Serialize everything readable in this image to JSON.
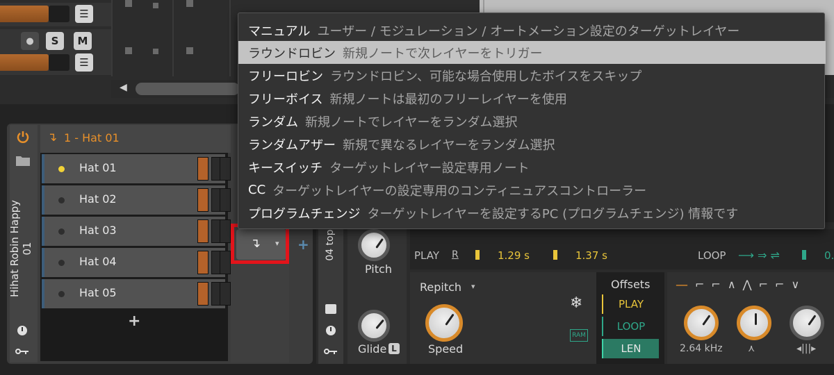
{
  "mixer": {
    "solo_label": "S",
    "mute_label": "M",
    "menu_glyph": "☰",
    "record_glyph": "●",
    "scroll_left_glyph": "◀"
  },
  "device": {
    "title": "Hihat Robin Happy 01",
    "layer_header": "1 - Hat 01",
    "add_glyph": "+",
    "power_icon": "power-icon",
    "folder_icon": "folder-icon",
    "layers": [
      {
        "name": "Hat 01",
        "active": true
      },
      {
        "name": "Hat 02",
        "active": false
      },
      {
        "name": "Hat 03",
        "active": false
      },
      {
        "name": "Hat 04",
        "active": false
      },
      {
        "name": "Hat 05",
        "active": false
      }
    ],
    "mode_button_glyph": "↴",
    "mode_dropdown_glyph": "▾"
  },
  "sampler": {
    "side_title": "04 top",
    "pitch_label": "Pitch",
    "glide_label": "Glide",
    "glide_badge": "L",
    "play_label": "PLAY",
    "r_label": "R",
    "play_start": "1.29 s",
    "play_end": "1.37 s",
    "loop_label": "LOOP",
    "loop_value": "0.",
    "repitch_label": "Repitch",
    "speed_label": "Speed",
    "ram_label": "RAM",
    "offsets_label": "Offsets",
    "offsets_buttons": [
      "PLAY",
      "LOOP",
      "LEN"
    ],
    "freq_label": "2.64 kHz",
    "snowflake_glyph": "❄"
  },
  "menu": {
    "items": [
      {
        "label": "マニュアル",
        "desc": "ユーザー / モジュレーション / オートメーション設定のターゲットレイヤー",
        "selected": false
      },
      {
        "label": "ラウンドロビン",
        "desc": "新規ノートで次レイヤーをトリガー",
        "selected": true
      },
      {
        "label": "フリーロビン",
        "desc": "ラウンドロビン、可能な場合使用したボイスをスキップ",
        "selected": false
      },
      {
        "label": "フリーボイス",
        "desc": "新規ノートは最初のフリーレイヤーを使用",
        "selected": false
      },
      {
        "label": "ランダム",
        "desc": "新規ノートでレイヤーをランダム選択",
        "selected": false
      },
      {
        "label": "ランダムアザー",
        "desc": "新規で異なるレイヤーをランダム選択",
        "selected": false
      },
      {
        "label": "キースイッチ",
        "desc": "ターゲットレイヤー設定専用ノート",
        "selected": false
      },
      {
        "label": "CC",
        "desc": "ターゲットレイヤーの設定専用のコンティニュアスコントローラー",
        "selected": false
      },
      {
        "label": "プログラムチェンジ",
        "desc": "ターゲットレイヤーを設定するPC (プログラムチェンジ) 情報です",
        "selected": false
      }
    ]
  },
  "colors": {
    "accent_orange": "#e8902a",
    "highlight_red": "#e3141b",
    "active_yellow": "#f1d237",
    "teal": "#2fa88a"
  }
}
